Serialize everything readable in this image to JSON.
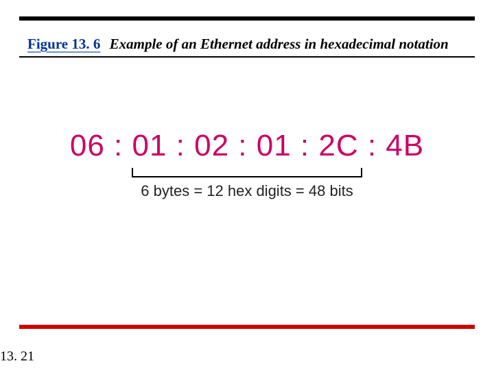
{
  "figure": {
    "label": "Figure 13. 6",
    "title": "Example of an Ethernet address in hexadecimal notation"
  },
  "mac_address": "06 : 01 : 02 : 01 : 2C : 4B",
  "subcaption": "6 bytes = 12 hex digits = 48 bits",
  "page_number": "13. 21"
}
